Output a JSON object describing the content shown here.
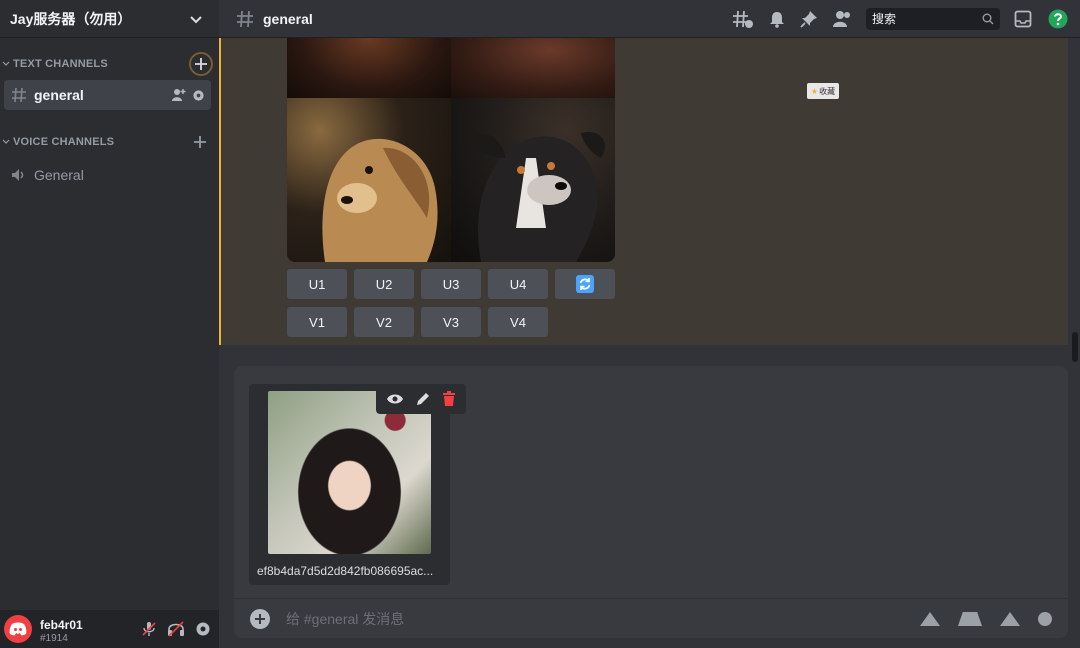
{
  "server": {
    "name": "Jay服务器（勿用）"
  },
  "sidebar": {
    "text_category": "TEXT CHANNELS",
    "voice_category": "VOICE CHANNELS",
    "text_channels": [
      {
        "name": "general"
      }
    ],
    "voice_channels": [
      {
        "name": "General"
      }
    ]
  },
  "user": {
    "name": "feb4r01",
    "tag": "#1914"
  },
  "header": {
    "channel": "general",
    "search_placeholder": "搜索"
  },
  "message": {
    "upscale_buttons": [
      "U1",
      "U2",
      "U3",
      "U4"
    ],
    "variation_buttons": [
      "V1",
      "V2",
      "V3",
      "V4"
    ],
    "sticker_label": "收藏"
  },
  "composer": {
    "attachment_filename": "ef8b4da7d5d2d842fb086695ac...",
    "placeholder": "给 #general 发消息"
  },
  "colors": {
    "accent_bar": "#f0b232",
    "delete_icon": "#f23f42",
    "help_icon": "#23a55a",
    "reroll_icon": "#4aa3ff"
  }
}
